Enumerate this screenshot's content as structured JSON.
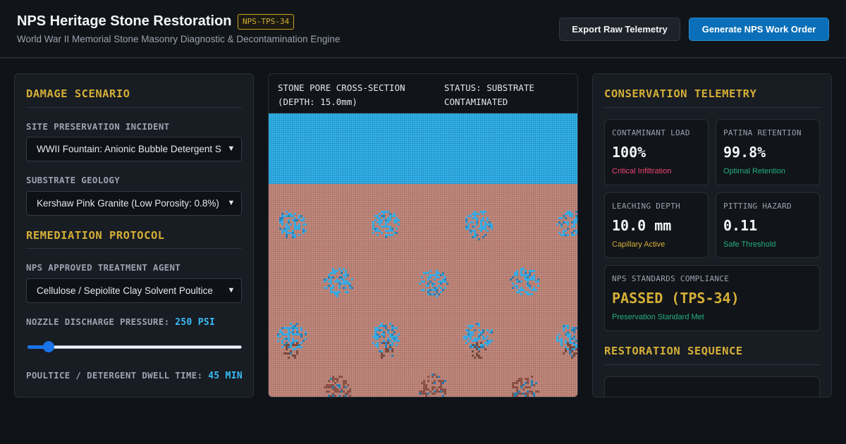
{
  "header": {
    "title": "NPS Heritage Stone Restoration",
    "badge": "NPS-TPS-34",
    "subtitle": "World War II Memorial Stone Masonry Diagnostic & Decontamination Engine",
    "export_label": "Export Raw Telemetry",
    "generate_label": "Generate NPS Work Order"
  },
  "left": {
    "damage_title": "DAMAGE SCENARIO",
    "incident_label": "SITE PRESERVATION INCIDENT",
    "incident_value": "WWII Fountain: Anionic Bubble Detergent S",
    "geology_label": "SUBSTRATE GEOLOGY",
    "geology_value": "Kershaw Pink Granite (Low Porosity: 0.8%)",
    "protocol_title": "REMEDIATION PROTOCOL",
    "agent_label": "NPS APPROVED TREATMENT AGENT",
    "agent_value": "Cellulose / Sepiolite Clay Solvent Poultice",
    "pressure_label": "NOZZLE DISCHARGE PRESSURE:",
    "pressure_value": "250 PSI",
    "pressure_fraction": 0.1,
    "dwell_label": "POULTICE / DETERGENT DWELL TIME:",
    "dwell_value": "45 MIN"
  },
  "viz": {
    "title_line1": "STONE PORE CROSS-SECTION",
    "title_line2": "(DEPTH: 15.0mm)",
    "status_line1": "STATUS: SUBSTRATE",
    "status_line2": "CONTAMINATED"
  },
  "right": {
    "telemetry_title": "CONSERVATION TELEMETRY",
    "cards": [
      {
        "label": "CONTAMINANT LOAD",
        "value": "100%",
        "status": "Critical Infiltration",
        "status_color": "#ef4470"
      },
      {
        "label": "PATINA RETENTION",
        "value": "99.8%",
        "status": "Optimal Retention",
        "status_color": "#22b07d"
      },
      {
        "label": "LEACHING DEPTH",
        "value": "10.0 mm",
        "status": "Capillary Active",
        "status_color": "#d4af37"
      },
      {
        "label": "PITTING HAZARD",
        "value": "0.11",
        "status": "Safe Threshold",
        "status_color": "#22b07d"
      }
    ],
    "compliance": {
      "label": "NPS STANDARDS COMPLIANCE",
      "value": "PASSED (TPS-34)",
      "status": "Preservation Standard Met",
      "value_color": "#d4af37",
      "status_color": "#22b07d"
    },
    "sequence_title": "RESTORATION SEQUENCE"
  },
  "colors": {
    "accent": "#d4af37",
    "primary": "#0a6fb8",
    "water": "#38bdf8",
    "stone": "#c48b80"
  }
}
